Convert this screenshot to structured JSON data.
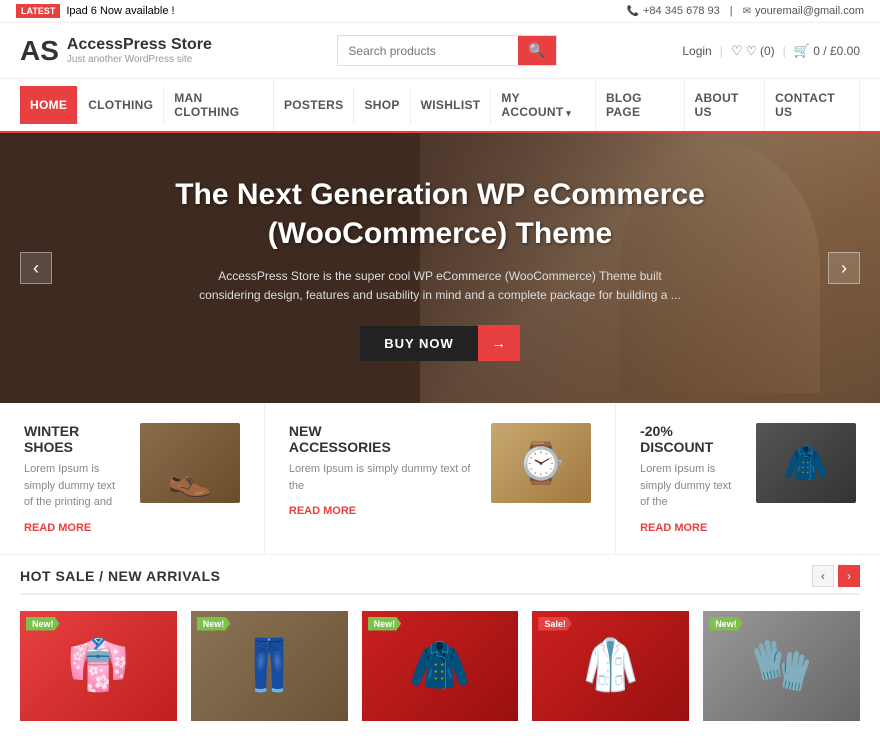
{
  "topbar": {
    "badge": "LATEST",
    "announcement": "Ipad 6 Now available !",
    "phone": "+84 345 678 93",
    "email": "youremail@gmail.com"
  },
  "header": {
    "logo_icon": "AS",
    "logo_title": "AccessPress Store",
    "logo_subtitle": "Just another WordPress site",
    "search_placeholder": "Search products",
    "login": "Login",
    "wishlist": "♡ (0)",
    "cart": "0 / £0.00"
  },
  "nav": {
    "items": [
      {
        "label": "HOME",
        "active": true
      },
      {
        "label": "CLOTHING",
        "active": false
      },
      {
        "label": "MAN CLOTHING",
        "active": false
      },
      {
        "label": "POSTERS",
        "active": false
      },
      {
        "label": "SHOP",
        "active": false
      },
      {
        "label": "WISHLIST",
        "active": false
      },
      {
        "label": "MY ACCOUNT",
        "active": false,
        "dropdown": true
      },
      {
        "label": "BLOG PAGE",
        "active": false
      },
      {
        "label": "ABOUT US",
        "active": false
      },
      {
        "label": "CONTACT US",
        "active": false
      }
    ]
  },
  "hero": {
    "title": "The Next Generation WP eCommerce (WooCommerce) Theme",
    "description": "AccessPress Store is the super cool WP eCommerce (WooCommerce) Theme  built considering design, features and usability in mind and a complete package for building a ...",
    "cta_label": "BUY NOW",
    "cta_arrow": "→"
  },
  "features": [
    {
      "title": "WINTER SHOES",
      "description": "Lorem Ipsum is simply dummy text of the printing and",
      "read_more": "READ MORE",
      "icon": "👞",
      "type": "shoes"
    },
    {
      "title": "NEW ACCESSORIES",
      "description": "Lorem Ipsum is simply dummy text of the",
      "read_more": "READ MORE",
      "icon": "⌚",
      "type": "watch"
    },
    {
      "title": "-20% DISCOUNT",
      "description": "Lorem Ipsum is simply dummy text of the",
      "read_more": "READ MORE",
      "icon": "🧥",
      "type": "jacket"
    }
  ],
  "hot_sale": {
    "title": "HOT SALE / NEW ARRIVALS",
    "prev": "‹",
    "next": "›",
    "products": [
      {
        "badge": "New!",
        "badge_type": "new",
        "icon": "👘",
        "type": "red-jacket"
      },
      {
        "badge": "New!",
        "badge_type": "new",
        "icon": "👖",
        "type": "pants"
      },
      {
        "badge": "New!",
        "badge_type": "new",
        "icon": "🧥",
        "type": "red-coat"
      },
      {
        "badge": "Sale!",
        "badge_type": "sale",
        "icon": "🥼",
        "type": "red-coat"
      },
      {
        "badge": "New!",
        "badge_type": "new",
        "icon": "🧤",
        "type": "gray-hoodie"
      }
    ]
  }
}
